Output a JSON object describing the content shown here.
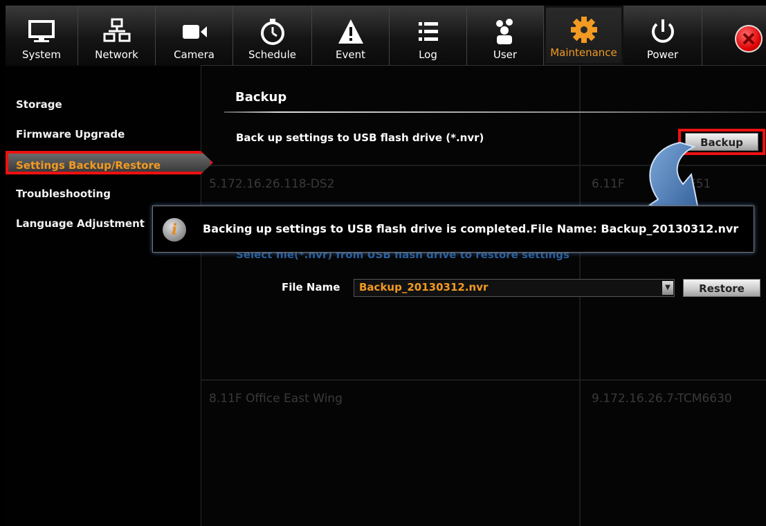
{
  "toolbar": {
    "tabs": [
      {
        "label": "System",
        "icon": "monitor-icon"
      },
      {
        "label": "Network",
        "icon": "network-icon"
      },
      {
        "label": "Camera",
        "icon": "camera-icon"
      },
      {
        "label": "Schedule",
        "icon": "stopwatch-icon"
      },
      {
        "label": "Event",
        "icon": "warning-icon"
      },
      {
        "label": "Log",
        "icon": "list-icon"
      },
      {
        "label": "User",
        "icon": "users-icon"
      },
      {
        "label": "Maintenance",
        "icon": "gear-icon",
        "active": true
      },
      {
        "label": "Power",
        "icon": "power-icon"
      }
    ],
    "close_icon": "close-icon"
  },
  "sidebar": {
    "items": [
      {
        "label": "Storage"
      },
      {
        "label": "Firmware Upgrade"
      },
      {
        "label": "Settings Backup/Restore",
        "active": true
      },
      {
        "label": "Troubleshooting"
      },
      {
        "label": "Language Adjustment"
      }
    ]
  },
  "background_cells": [
    "5.172.16.26.118-DS2",
    "6.11F",
    "E51",
    "8.11F Office East Wing",
    "9.172.16.26.7-TCM6630"
  ],
  "main": {
    "section_title": "Backup",
    "backup_description": "Back up settings to USB flash drive (*.nvr)",
    "backup_button": "Backup",
    "restore_hint": "Select file(*.nvr) from USB flash drive to restore settings",
    "file_name_label": "File Name",
    "file_name_value": "Backup_20130312.nvr",
    "restore_button": "Restore"
  },
  "popup": {
    "message": "Backing up settings to USB flash drive is completed.File Name: Backup_20130312.nvr",
    "icon": "info-icon"
  },
  "colors": {
    "accent": "#f29a22",
    "highlight": "#ee1111",
    "arrow": "#4a7ab8"
  }
}
